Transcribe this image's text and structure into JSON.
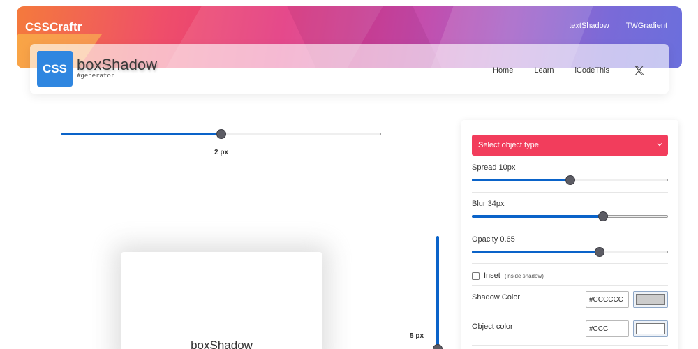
{
  "brand": {
    "name": "CSSCraftr"
  },
  "top_nav": [
    {
      "label": "textShadow"
    },
    {
      "label": "TWGradient"
    }
  ],
  "logo": {
    "badge": "CSS",
    "title": "boxShadow",
    "subtitle": "#generator"
  },
  "main_nav": [
    {
      "label": "Home"
    },
    {
      "label": "Learn"
    },
    {
      "label": "iCodeThis"
    }
  ],
  "social_icon": "x-twitter-icon",
  "canvas": {
    "horizontal_offset": {
      "label": "2 px",
      "value": 2,
      "fraction": 0.5
    },
    "vertical_offset": {
      "label": "5 px",
      "value": 5,
      "fraction": 1.0
    },
    "preview_label": "boxShadow"
  },
  "panel": {
    "object_type": {
      "label": "Select object type",
      "color": "#f23d5c"
    },
    "spread": {
      "label": "Spread 10px",
      "value": 10,
      "fraction": 0.5
    },
    "blur": {
      "label": "Blur 34px",
      "value": 34,
      "fraction": 0.67
    },
    "opacity": {
      "label": "Opacity 0.65",
      "value": 0.65,
      "fraction": 0.65
    },
    "inset": {
      "label": "Inset",
      "hint": "(inside shadow)",
      "checked": false
    },
    "shadow_color": {
      "label": "Shadow Color",
      "value": "#CCCCCC",
      "swatch": "#cccccc"
    },
    "object_color": {
      "label": "Object color",
      "value": "#CCC",
      "swatch": "#ffffff"
    }
  },
  "colors": {
    "accent": "#0a63c9",
    "select_bg": "#f23d5c",
    "logo_bg": "#2f86e0"
  }
}
